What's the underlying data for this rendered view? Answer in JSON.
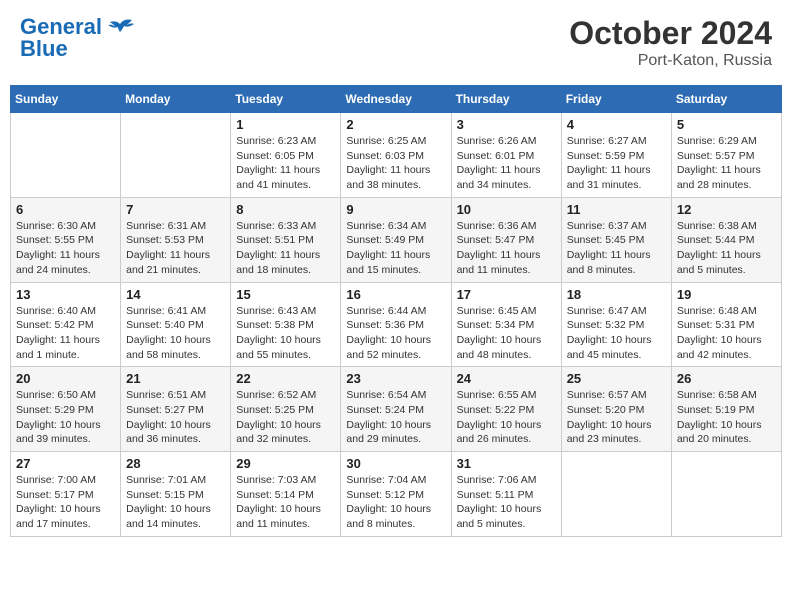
{
  "header": {
    "logo_line1": "General",
    "logo_line2": "Blue",
    "month": "October 2024",
    "location": "Port-Katon, Russia"
  },
  "weekdays": [
    "Sunday",
    "Monday",
    "Tuesday",
    "Wednesday",
    "Thursday",
    "Friday",
    "Saturday"
  ],
  "weeks": [
    [
      {
        "day": "",
        "info": ""
      },
      {
        "day": "",
        "info": ""
      },
      {
        "day": "1",
        "info": "Sunrise: 6:23 AM\nSunset: 6:05 PM\nDaylight: 11 hours and 41 minutes."
      },
      {
        "day": "2",
        "info": "Sunrise: 6:25 AM\nSunset: 6:03 PM\nDaylight: 11 hours and 38 minutes."
      },
      {
        "day": "3",
        "info": "Sunrise: 6:26 AM\nSunset: 6:01 PM\nDaylight: 11 hours and 34 minutes."
      },
      {
        "day": "4",
        "info": "Sunrise: 6:27 AM\nSunset: 5:59 PM\nDaylight: 11 hours and 31 minutes."
      },
      {
        "day": "5",
        "info": "Sunrise: 6:29 AM\nSunset: 5:57 PM\nDaylight: 11 hours and 28 minutes."
      }
    ],
    [
      {
        "day": "6",
        "info": "Sunrise: 6:30 AM\nSunset: 5:55 PM\nDaylight: 11 hours and 24 minutes."
      },
      {
        "day": "7",
        "info": "Sunrise: 6:31 AM\nSunset: 5:53 PM\nDaylight: 11 hours and 21 minutes."
      },
      {
        "day": "8",
        "info": "Sunrise: 6:33 AM\nSunset: 5:51 PM\nDaylight: 11 hours and 18 minutes."
      },
      {
        "day": "9",
        "info": "Sunrise: 6:34 AM\nSunset: 5:49 PM\nDaylight: 11 hours and 15 minutes."
      },
      {
        "day": "10",
        "info": "Sunrise: 6:36 AM\nSunset: 5:47 PM\nDaylight: 11 hours and 11 minutes."
      },
      {
        "day": "11",
        "info": "Sunrise: 6:37 AM\nSunset: 5:45 PM\nDaylight: 11 hours and 8 minutes."
      },
      {
        "day": "12",
        "info": "Sunrise: 6:38 AM\nSunset: 5:44 PM\nDaylight: 11 hours and 5 minutes."
      }
    ],
    [
      {
        "day": "13",
        "info": "Sunrise: 6:40 AM\nSunset: 5:42 PM\nDaylight: 11 hours and 1 minute."
      },
      {
        "day": "14",
        "info": "Sunrise: 6:41 AM\nSunset: 5:40 PM\nDaylight: 10 hours and 58 minutes."
      },
      {
        "day": "15",
        "info": "Sunrise: 6:43 AM\nSunset: 5:38 PM\nDaylight: 10 hours and 55 minutes."
      },
      {
        "day": "16",
        "info": "Sunrise: 6:44 AM\nSunset: 5:36 PM\nDaylight: 10 hours and 52 minutes."
      },
      {
        "day": "17",
        "info": "Sunrise: 6:45 AM\nSunset: 5:34 PM\nDaylight: 10 hours and 48 minutes."
      },
      {
        "day": "18",
        "info": "Sunrise: 6:47 AM\nSunset: 5:32 PM\nDaylight: 10 hours and 45 minutes."
      },
      {
        "day": "19",
        "info": "Sunrise: 6:48 AM\nSunset: 5:31 PM\nDaylight: 10 hours and 42 minutes."
      }
    ],
    [
      {
        "day": "20",
        "info": "Sunrise: 6:50 AM\nSunset: 5:29 PM\nDaylight: 10 hours and 39 minutes."
      },
      {
        "day": "21",
        "info": "Sunrise: 6:51 AM\nSunset: 5:27 PM\nDaylight: 10 hours and 36 minutes."
      },
      {
        "day": "22",
        "info": "Sunrise: 6:52 AM\nSunset: 5:25 PM\nDaylight: 10 hours and 32 minutes."
      },
      {
        "day": "23",
        "info": "Sunrise: 6:54 AM\nSunset: 5:24 PM\nDaylight: 10 hours and 29 minutes."
      },
      {
        "day": "24",
        "info": "Sunrise: 6:55 AM\nSunset: 5:22 PM\nDaylight: 10 hours and 26 minutes."
      },
      {
        "day": "25",
        "info": "Sunrise: 6:57 AM\nSunset: 5:20 PM\nDaylight: 10 hours and 23 minutes."
      },
      {
        "day": "26",
        "info": "Sunrise: 6:58 AM\nSunset: 5:19 PM\nDaylight: 10 hours and 20 minutes."
      }
    ],
    [
      {
        "day": "27",
        "info": "Sunrise: 7:00 AM\nSunset: 5:17 PM\nDaylight: 10 hours and 17 minutes."
      },
      {
        "day": "28",
        "info": "Sunrise: 7:01 AM\nSunset: 5:15 PM\nDaylight: 10 hours and 14 minutes."
      },
      {
        "day": "29",
        "info": "Sunrise: 7:03 AM\nSunset: 5:14 PM\nDaylight: 10 hours and 11 minutes."
      },
      {
        "day": "30",
        "info": "Sunrise: 7:04 AM\nSunset: 5:12 PM\nDaylight: 10 hours and 8 minutes."
      },
      {
        "day": "31",
        "info": "Sunrise: 7:06 AM\nSunset: 5:11 PM\nDaylight: 10 hours and 5 minutes."
      },
      {
        "day": "",
        "info": ""
      },
      {
        "day": "",
        "info": ""
      }
    ]
  ]
}
